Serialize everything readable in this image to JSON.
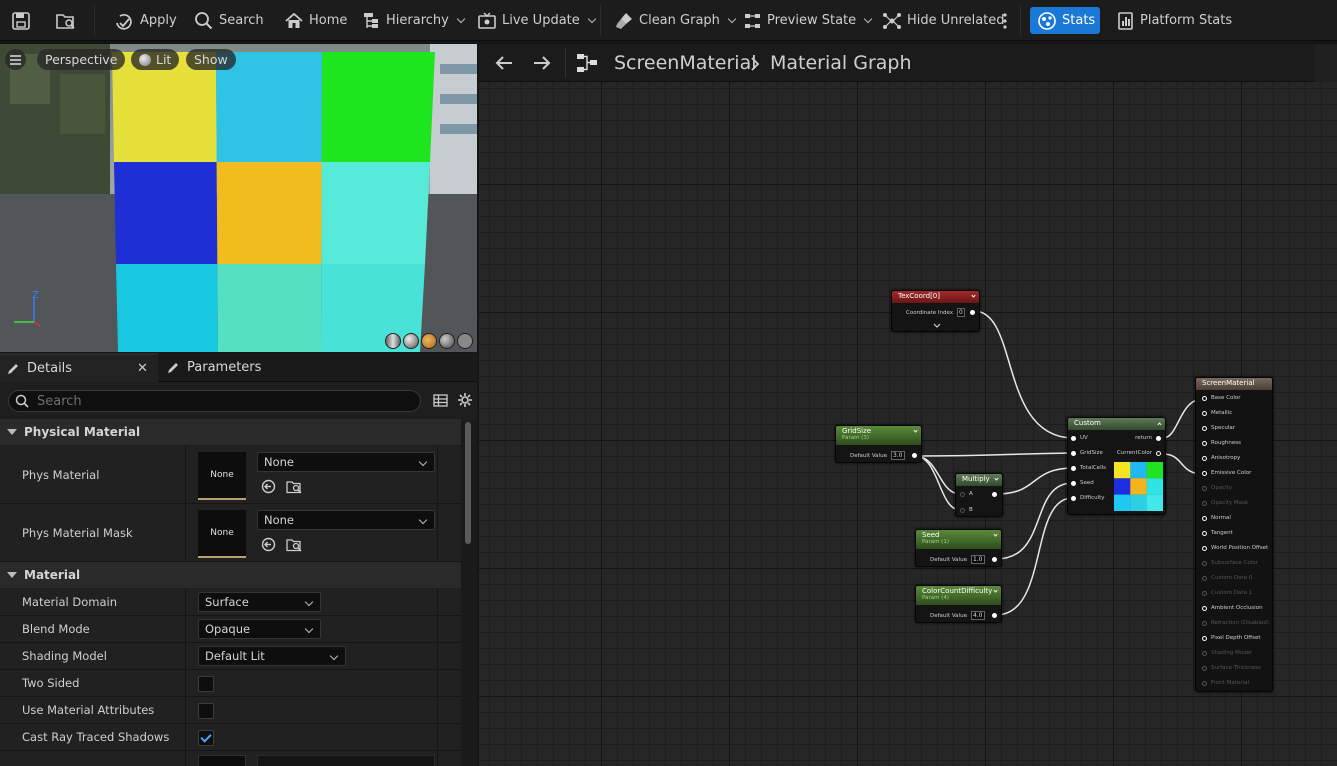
{
  "toolbar": {
    "apply": "Apply",
    "search": "Search",
    "home": "Home",
    "hierarchy": "Hierarchy",
    "live_update": "Live Update",
    "clean_graph": "Clean Graph",
    "preview_state": "Preview State",
    "hide_unrelated": "Hide Unrelated",
    "stats": "Stats",
    "platform_stats": "Platform Stats"
  },
  "colors": {
    "accent": "#1a78d6",
    "checkbox_check": "#4ea3ff"
  },
  "viewport": {
    "perspective": "Perspective",
    "lit": "Lit",
    "show": "Show",
    "axis_z": "Z",
    "preview_grid": [
      "#e6e03a",
      "#2fc4e6",
      "#1ee61e",
      "#1e2fd6",
      "#f0bd1c",
      "#58ead8",
      "#18c8e0",
      "#56e0c2",
      "#48e2d6"
    ]
  },
  "details": {
    "tab_details": "Details",
    "tab_parameters": "Parameters",
    "search_placeholder": "Search",
    "cat_physical": "Physical Material",
    "phys_material_label": "Phys Material",
    "phys_material_thumb": "None",
    "phys_material_value": "None",
    "phys_mask_label": "Phys Material Mask",
    "phys_mask_thumb": "None",
    "phys_mask_value": "None",
    "cat_material": "Material",
    "material_domain_label": "Material Domain",
    "material_domain_value": "Surface",
    "blend_mode_label": "Blend Mode",
    "blend_mode_value": "Opaque",
    "shading_model_label": "Shading Model",
    "shading_model_value": "Default Lit",
    "two_sided_label": "Two Sided",
    "two_sided": false,
    "use_attrs_label": "Use Material Attributes",
    "use_attrs": false,
    "cast_rt_label": "Cast Ray Traced Shadows",
    "cast_rt": true
  },
  "graph": {
    "crumb_asset": "ScreenMaterial",
    "crumb_graph": "Material Graph",
    "texcoord": {
      "title": "TexCoord[0]",
      "pin": "Coordinate Index",
      "value": "0"
    },
    "gridsize": {
      "title": "GridSize",
      "sub": "Param (3)",
      "pin": "Default Value",
      "value": "3.0"
    },
    "multiply": {
      "title": "Multiply",
      "a": "A",
      "b": "B"
    },
    "seed": {
      "title": "Seed",
      "sub": "Param (1)",
      "pin": "Default Value",
      "value": "1.0"
    },
    "colorcount": {
      "title": "ColorCountDifficulty",
      "sub": "Param (4)",
      "pin": "Default Value",
      "value": "4.0"
    },
    "custom": {
      "title": "Custom",
      "in_uv": "UV",
      "in_gridsize": "GridSize",
      "in_totalcells": "TotalCells",
      "in_seed": "Seed",
      "in_difficulty": "Difficulty",
      "out_return": "return",
      "out_currentcolor": "CurrentColor",
      "preview_grid": [
        "#f4e421",
        "#21b8f4",
        "#21e421",
        "#1e2ee0",
        "#f4b41c",
        "#2ee4e4",
        "#1ec8f0",
        "#2ecfe4",
        "#40e8e8"
      ]
    },
    "output": {
      "title": "ScreenMaterial",
      "pins": [
        "Base Color",
        "Metallic",
        "Specular",
        "Roughness",
        "Anisotropy",
        "Emissive Color",
        "Opacity",
        "Opacity Mask",
        "Normal",
        "Tangent",
        "World Position Offset",
        "Subsurface Color",
        "Custom Data 0",
        "Custom Data 1",
        "Ambient Occlusion",
        "Refraction (Disabled)",
        "Pixel Depth Offset",
        "Shading Model",
        "Surface Thickness",
        "Front Material"
      ]
    }
  }
}
